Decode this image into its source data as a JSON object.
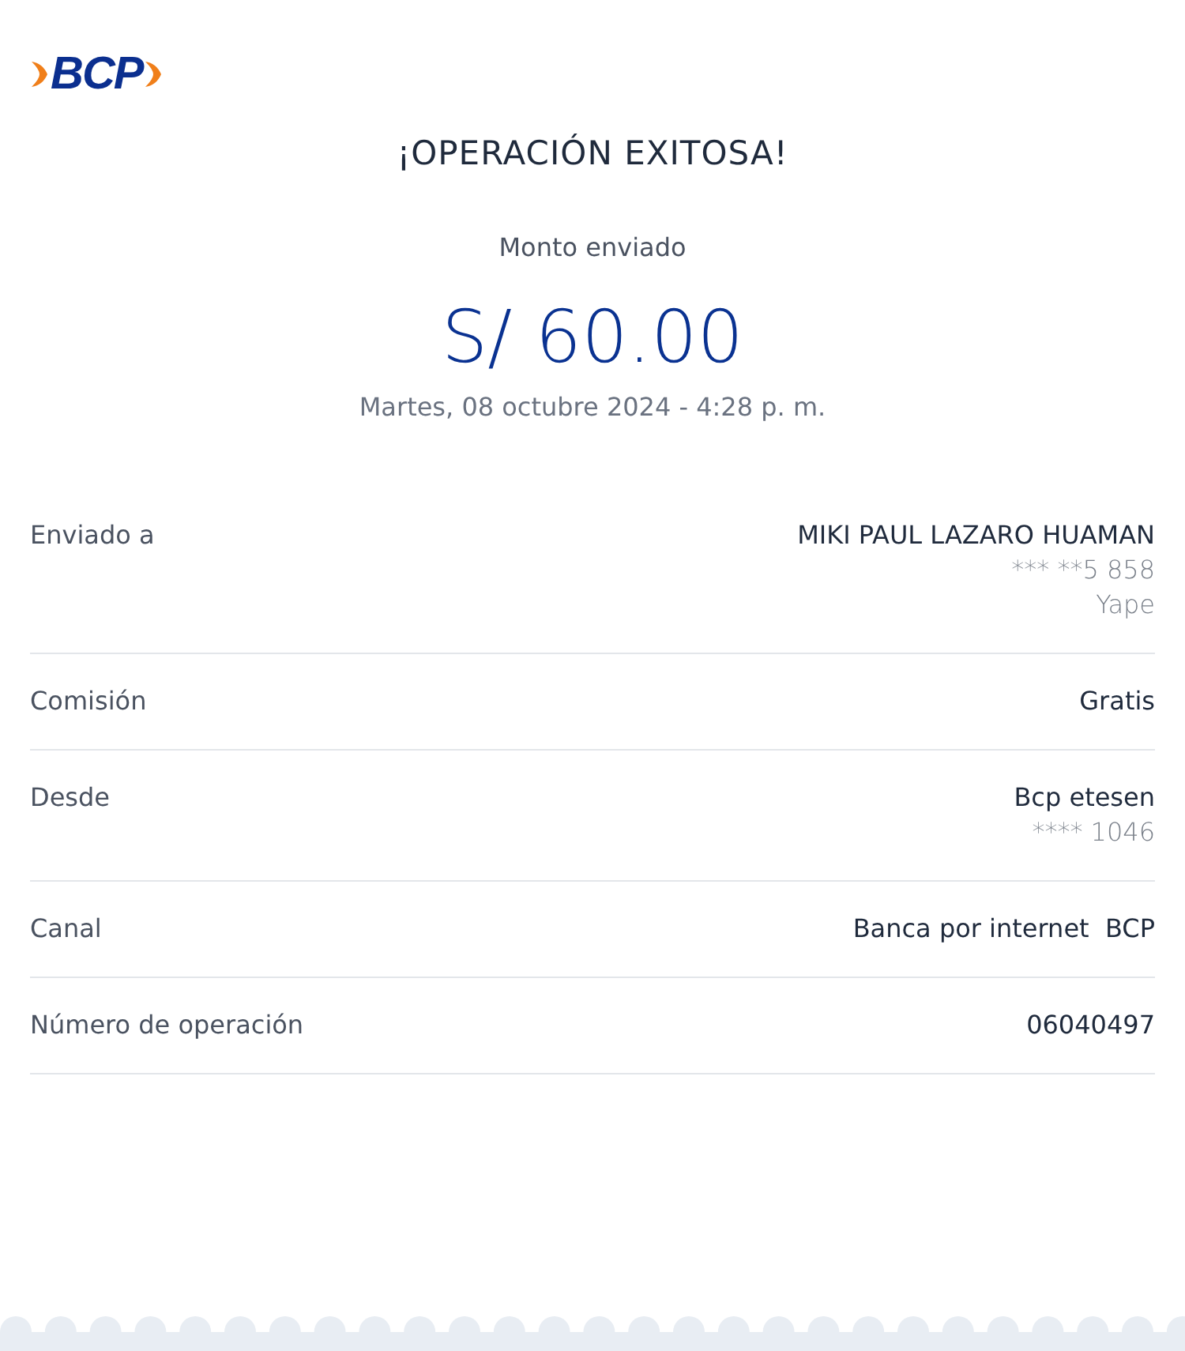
{
  "logo": {
    "text": "BCP"
  },
  "title": "¡OPERACIÓN EXITOSA!",
  "amount_label": "Monto enviado",
  "amount": "S/ 60.00",
  "date": "Martes, 08 octubre 2024 - 4:28 p. m.",
  "details": [
    {
      "label": "Enviado a",
      "values": [
        "MIKI PAUL LAZARO HUAMAN",
        "*** **5 858",
        "Yape"
      ]
    },
    {
      "label": "Comisión",
      "values": [
        "Gratis"
      ]
    },
    {
      "label": "Desde",
      "values": [
        "Bcp etesen",
        "**** 1046"
      ]
    },
    {
      "label": "Canal",
      "values": [
        "Banca por internet  BCP"
      ]
    },
    {
      "label": "Número de operación",
      "values": [
        "06040497"
      ]
    }
  ]
}
